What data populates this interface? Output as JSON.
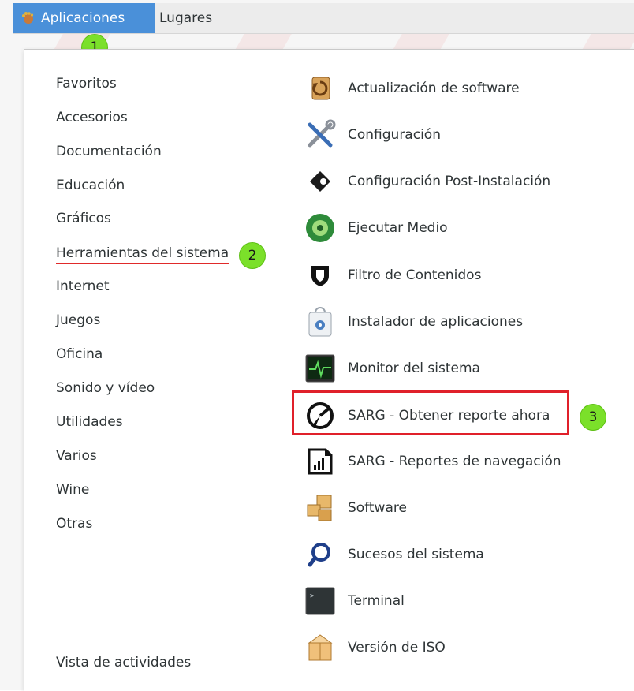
{
  "topbar": {
    "applications_label": "Aplicaciones",
    "places_label": "Lugares"
  },
  "categories": [
    "Favoritos",
    "Accesorios",
    "Documentación",
    "Educación",
    "Gráficos",
    "Herramientas del sistema",
    "Internet",
    "Juegos",
    "Oficina",
    "Sonido y vídeo",
    "Utilidades",
    "Varios",
    "Wine",
    "Otras"
  ],
  "footer": {
    "activities_label": "Vista de actividades"
  },
  "apps": [
    {
      "label": "Actualización de software",
      "icon": "software-update-icon"
    },
    {
      "label": "Configuración",
      "icon": "settings-tools-icon"
    },
    {
      "label": "Configuración Post-Instalación",
      "icon": "post-install-icon"
    },
    {
      "label": "Ejecutar Medio",
      "icon": "run-media-icon"
    },
    {
      "label": "Filtro de Contenidos",
      "icon": "shield-icon"
    },
    {
      "label": "Instalador de aplicaciones",
      "icon": "app-installer-icon"
    },
    {
      "label": "Monitor del sistema",
      "icon": "system-monitor-icon"
    },
    {
      "label": "SARG - Obtener reporte ahora",
      "icon": "sarg-report-now-icon"
    },
    {
      "label": "SARG - Reportes de navegación",
      "icon": "sarg-reports-icon"
    },
    {
      "label": "Software",
      "icon": "software-boxes-icon"
    },
    {
      "label": "Sucesos del sistema",
      "icon": "magnifier-icon"
    },
    {
      "label": "Terminal",
      "icon": "terminal-icon"
    },
    {
      "label": "Versión de ISO",
      "icon": "iso-version-icon"
    }
  ],
  "annotations": {
    "badge1": "1",
    "badge2": "2",
    "badge3": "3"
  },
  "colors": {
    "accent": "#4a90d9",
    "annotation_red": "#e0202a",
    "badge_green": "#7be02a"
  }
}
